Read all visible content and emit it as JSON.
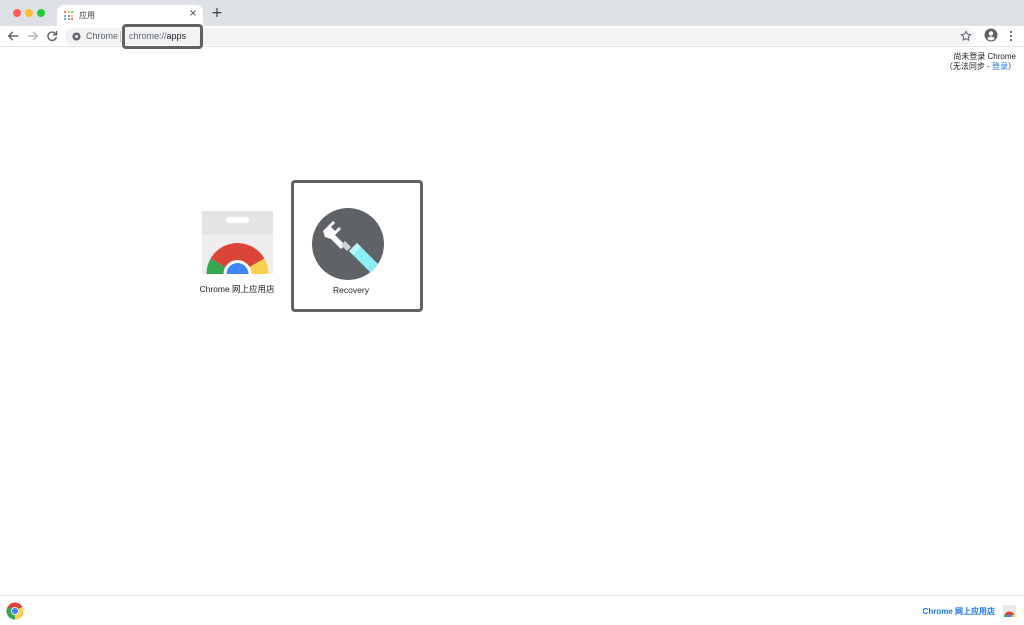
{
  "window": {
    "tab_title": "应用",
    "tab_close_glyph": "×",
    "new_tab_glyph": "+"
  },
  "toolbar": {
    "site_chip_label": "Chrome",
    "url_scheme": "chrome://",
    "url_path": "apps",
    "icons": [
      "back-arrow-icon",
      "forward-arrow-icon",
      "reload-icon",
      "star-icon",
      "profile-icon",
      "menu-dots-icon"
    ]
  },
  "signin": {
    "line1": "尚未登录 Chrome",
    "line2_prefix": "（无法同步 - ",
    "line2_link": "登录",
    "line2_suffix": "）"
  },
  "apps": [
    {
      "label": "Chrome 网上应用店",
      "icon": "chrome-web-store-icon"
    },
    {
      "label": "Recovery",
      "icon": "recovery-wrench-icon"
    }
  ],
  "footer": {
    "store_link": "Chrome 网上应用店",
    "icons": [
      "chrome-logo-icon",
      "chrome-web-store-small-icon"
    ]
  },
  "colors": {
    "link_blue": "#1a73e8",
    "highlight_border": "#616161",
    "tab_strip": "#dee1e6",
    "omnibox_bg": "#f1f3f4"
  }
}
